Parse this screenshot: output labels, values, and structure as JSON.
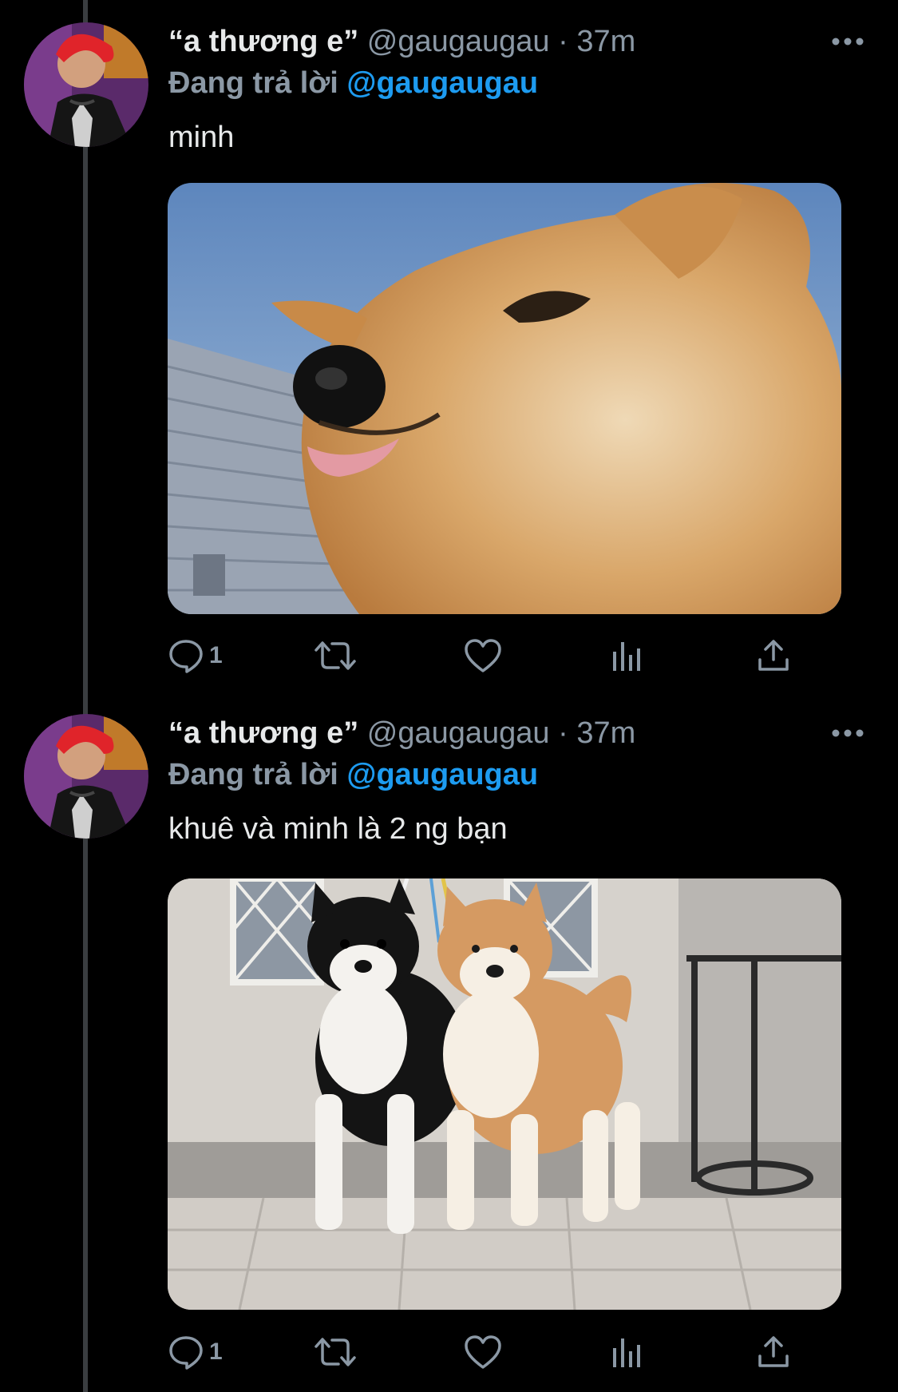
{
  "thread": {
    "tweets": [
      {
        "display_name": "“a thương e”",
        "handle": "@gaugaugau",
        "separator": "·",
        "time": "37m",
        "reply_label": "Đang trả lời",
        "reply_to": "@gaugaugau",
        "text": "minh",
        "actions": {
          "reply_count": "1",
          "retweet_count": "",
          "like_count": ""
        }
      },
      {
        "display_name": "“a thương e”",
        "handle": "@gaugaugau",
        "separator": "·",
        "time": "37m",
        "reply_label": "Đang trả lời",
        "reply_to": "@gaugaugau",
        "text": "khuê và minh là 2 ng bạn",
        "actions": {
          "reply_count": "1",
          "retweet_count": "",
          "like_count": ""
        }
      }
    ]
  },
  "colors": {
    "background": "#000000",
    "text_primary": "#e7e9ea",
    "text_secondary": "#8b98a5",
    "accent": "#1d9bf0",
    "thread_line": "#3a3d40"
  },
  "icons": {
    "more": "more-horizontal-icon",
    "reply": "reply-bubble-icon",
    "retweet": "retweet-icon",
    "like": "heart-icon",
    "views": "views-bar-icon",
    "share": "share-upload-icon"
  }
}
